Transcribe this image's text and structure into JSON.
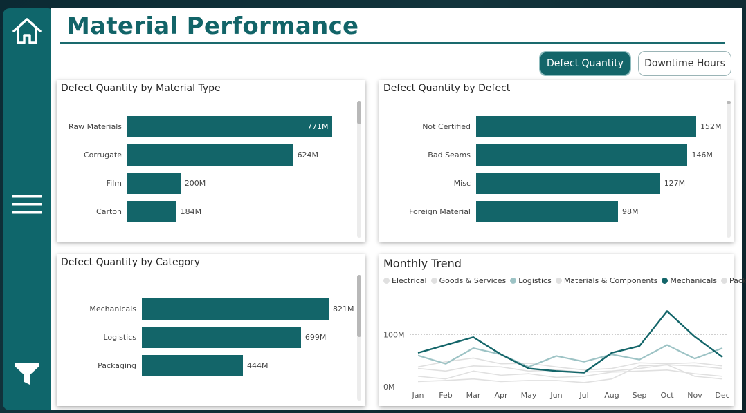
{
  "page": {
    "title": "Material Performance"
  },
  "nav": {
    "home_icon": "home-icon",
    "menu_icon": "hamburger-menu-icon",
    "filter_icon": "filter-icon"
  },
  "toggles": {
    "defect_quantity": "Defect Quantity",
    "downtime_hours": "Downtime Hours"
  },
  "colors": {
    "primary": "#136569",
    "logistics": "#9dc3c5",
    "light_series": "#dedede"
  },
  "material_card": {
    "title": "Defect Quantity by Material Type",
    "bars": [
      {
        "label": "Raw Materials",
        "value": 771,
        "text": "771M"
      },
      {
        "label": "Corrugate",
        "value": 624,
        "text": "624M"
      },
      {
        "label": "Film",
        "value": 200,
        "text": "200M"
      },
      {
        "label": "Carton",
        "value": 184,
        "text": "184M"
      }
    ]
  },
  "defect_card": {
    "title": "Defect Quantity by Defect",
    "bars": [
      {
        "label": "Not Certified",
        "value": 152,
        "text": "152M"
      },
      {
        "label": "Bad Seams",
        "value": 146,
        "text": "146M"
      },
      {
        "label": "Misc",
        "value": 127,
        "text": "127M"
      },
      {
        "label": "Foreign Material",
        "value": 98,
        "text": "98M"
      }
    ]
  },
  "category_card": {
    "title": "Defect Quantity by Category",
    "bars": [
      {
        "label": "Mechanicals",
        "value": 821,
        "text": "821M"
      },
      {
        "label": "Logistics",
        "value": 699,
        "text": "699M"
      },
      {
        "label": "Packaging",
        "value": 444,
        "text": "444M"
      }
    ]
  },
  "trend_card": {
    "title": "Monthly Trend"
  },
  "chart_data": {
    "type": "line",
    "title": "Monthly Trend",
    "x": [
      "Jan",
      "Feb",
      "Mar",
      "Apr",
      "May",
      "Jun",
      "Jul",
      "Aug",
      "Sep",
      "Oct",
      "Nov",
      "Dec"
    ],
    "y_ticks": [
      "100M",
      "0M"
    ],
    "ylim": [
      0,
      180
    ],
    "grid": true,
    "legend_position": "top-left",
    "series": [
      {
        "name": "Electrical",
        "color": "#e0e0e0",
        "values": [
          20,
          15,
          30,
          22,
          25,
          18,
          20,
          28,
          30,
          32,
          25,
          20
        ]
      },
      {
        "name": "Goods & Services",
        "color": "#e0e0e0",
        "values": [
          35,
          30,
          40,
          38,
          30,
          32,
          28,
          30,
          35,
          42,
          40,
          35
        ]
      },
      {
        "name": "Logistics",
        "color": "#9dc3c5",
        "values": [
          60,
          44,
          74,
          62,
          38,
          59,
          48,
          62,
          52,
          80,
          54,
          74
        ]
      },
      {
        "name": "Materials & Components",
        "color": "#e0e0e0",
        "values": [
          38,
          48,
          55,
          44,
          45,
          38,
          32,
          35,
          46,
          44,
          46,
          40
        ]
      },
      {
        "name": "Mechanicals",
        "color": "#136569",
        "values": [
          65,
          80,
          95,
          62,
          35,
          30,
          27,
          65,
          78,
          145,
          96,
          57
        ]
      },
      {
        "name": "Packaging",
        "color": "#e0e0e0",
        "values": [
          10,
          12,
          15,
          10,
          12,
          12,
          8,
          15,
          40,
          42,
          20,
          15
        ]
      }
    ]
  }
}
